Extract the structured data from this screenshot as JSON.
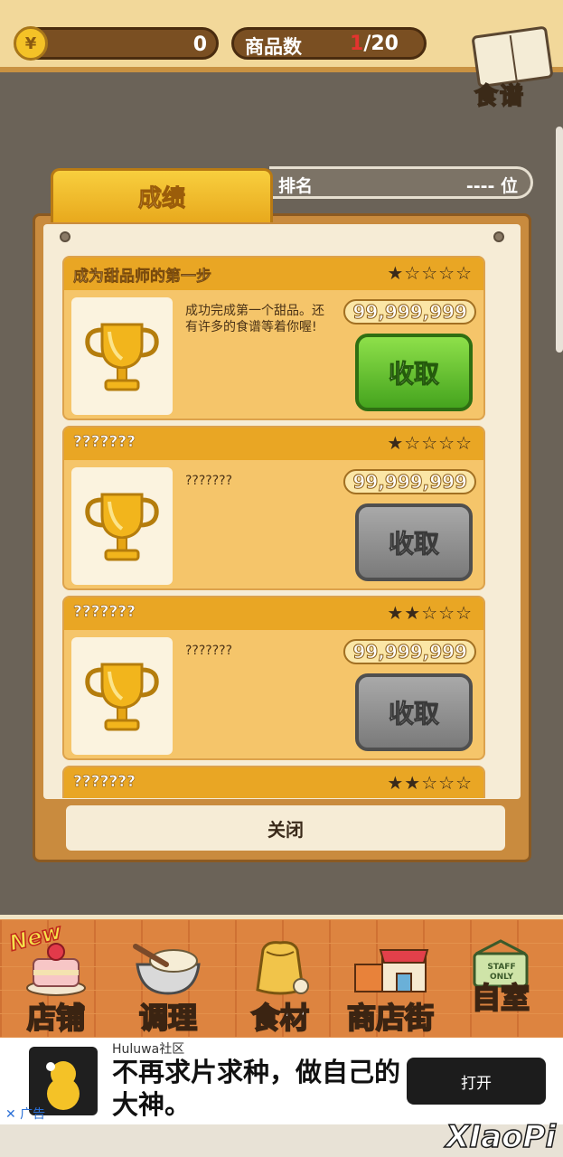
{
  "top": {
    "coin_symbol": "¥",
    "coin_value": "0",
    "goods_label": "商品数",
    "goods_current": "1",
    "goods_total": "/20",
    "recipe_label": "食谱"
  },
  "tabs": {
    "achievements": "成绩",
    "rank_label": "排名",
    "rank_value": "---- 位"
  },
  "achievements": [
    {
      "title": "成为甜品师的第一步",
      "stars": "★☆☆☆☆",
      "desc": "成功完成第一个甜品。还有许多的食谱等着你喔!",
      "reward": "99,999,999",
      "claim": "收取",
      "claim_state": "active"
    },
    {
      "title": "???????",
      "stars": "★☆☆☆☆",
      "desc": "???????",
      "reward": "99,999,999",
      "claim": "收取",
      "claim_state": "disabled"
    },
    {
      "title": "???????",
      "stars": "★★☆☆☆",
      "desc": "???????",
      "reward": "99,999,999",
      "claim": "收取",
      "claim_state": "disabled"
    },
    {
      "title": "???????",
      "stars": "★★☆☆☆"
    }
  ],
  "close_label": "关闭",
  "nav": {
    "new_badge": "New",
    "items": [
      {
        "label": "店铺",
        "icon": "cake-icon"
      },
      {
        "label": "调理",
        "icon": "mixing-bowl-icon"
      },
      {
        "label": "食材",
        "icon": "ingredient-bag-icon"
      },
      {
        "label": "商店街",
        "icon": "shop-street-icon"
      },
      {
        "label": "自室",
        "icon": "staff-only-door-icon"
      }
    ],
    "staff_sign": "STAFF ONLY"
  },
  "ad": {
    "brand": "Huluwa社区",
    "title": "不再求片求种，做自己的大神。",
    "button": "打开",
    "tag": "✕ 广告"
  },
  "watermark": "XIaoPi"
}
